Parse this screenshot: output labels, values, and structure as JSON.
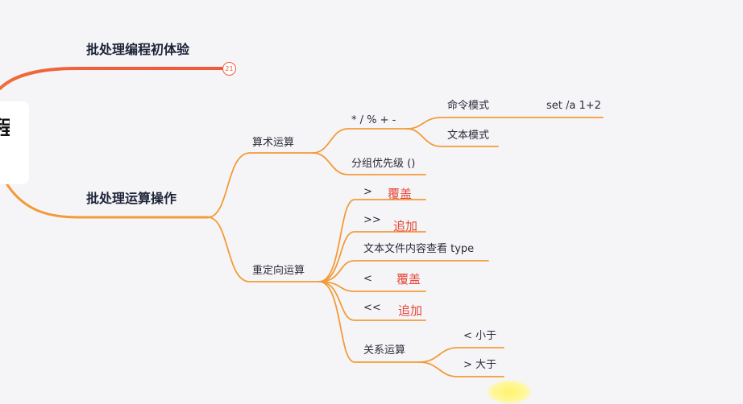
{
  "root": {
    "label": "程"
  },
  "branch1": {
    "label": "批处理编程初体验",
    "badge": "21"
  },
  "branch2": {
    "label": "批处理运算操作"
  },
  "arith": {
    "label": "算术运算",
    "ops": {
      "label": "* / % + -"
    },
    "cmd_mode": {
      "label": "命令模式",
      "example": "set /a 1+2"
    },
    "text_mode": {
      "label": "文本模式"
    },
    "group_priority": {
      "label": "分组优先级 ()"
    }
  },
  "redirect": {
    "label": "重定向运算",
    "gt": {
      "symbol": ">",
      "note": "覆盖"
    },
    "gtgt": {
      "symbol": ">>",
      "note": "追加"
    },
    "type": {
      "label": "文本文件内容查看 type"
    },
    "lt": {
      "symbol": "<",
      "note": "覆盖"
    },
    "ltlt": {
      "symbol": "<<",
      "note": "追加"
    },
    "relation": {
      "label": "关系运算",
      "less": "< 小于",
      "greater": "> 大于"
    }
  },
  "colors": {
    "branch1_line": "#ee5a3b",
    "branch2_line": "#f39b37",
    "note_red": "#e5483a",
    "background": "#f5f5f8"
  }
}
